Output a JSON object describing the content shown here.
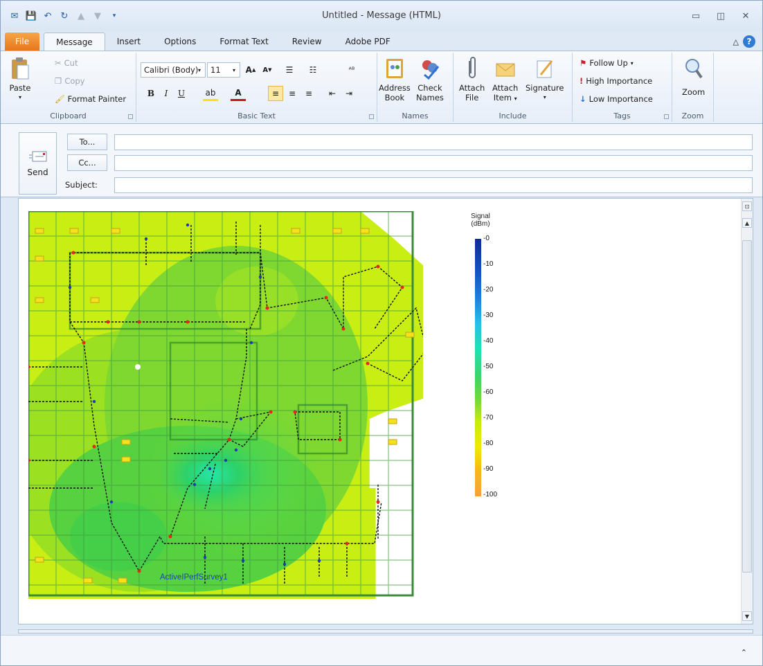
{
  "window": {
    "title": "Untitled  -  Message (HTML)"
  },
  "tabs": [
    "File",
    "Message",
    "Insert",
    "Options",
    "Format Text",
    "Review",
    "Adobe PDF"
  ],
  "active_tab": "Message",
  "clipboard": {
    "paste": "Paste",
    "cut": "Cut",
    "copy": "Copy",
    "format_painter": "Format Painter",
    "label": "Clipboard"
  },
  "basic_text": {
    "font": "Calibri (Body)",
    "size": "11",
    "label": "Basic Text"
  },
  "names": {
    "address_book": "Address\nBook",
    "address_book_l1": "Address",
    "address_book_l2": "Book",
    "check_names_l1": "Check",
    "check_names_l2": "Names",
    "label": "Names"
  },
  "include": {
    "attach_file_l1": "Attach",
    "attach_file_l2": "File",
    "attach_item_l1": "Attach",
    "attach_item_l2": "Item",
    "signature": "Signature",
    "label": "Include"
  },
  "tags": {
    "follow_up": "Follow Up",
    "high": "High Importance",
    "low": "Low Importance",
    "label": "Tags"
  },
  "zoom": {
    "button": "Zoom",
    "label": "Zoom"
  },
  "header": {
    "send": "Send",
    "to": "To...",
    "cc": "Cc...",
    "subject": "Subject:",
    "to_value": "",
    "cc_value": "",
    "subject_value": ""
  },
  "legend": {
    "title_l1": "Signal",
    "title_l2": "(dBm)",
    "ticks": [
      "-0",
      "-10",
      "-20",
      "-30",
      "-40",
      "-50",
      "-60",
      "-70",
      "-80",
      "-90",
      "-100"
    ]
  },
  "map": {
    "label": "ActiveIPerfSurvey1"
  }
}
